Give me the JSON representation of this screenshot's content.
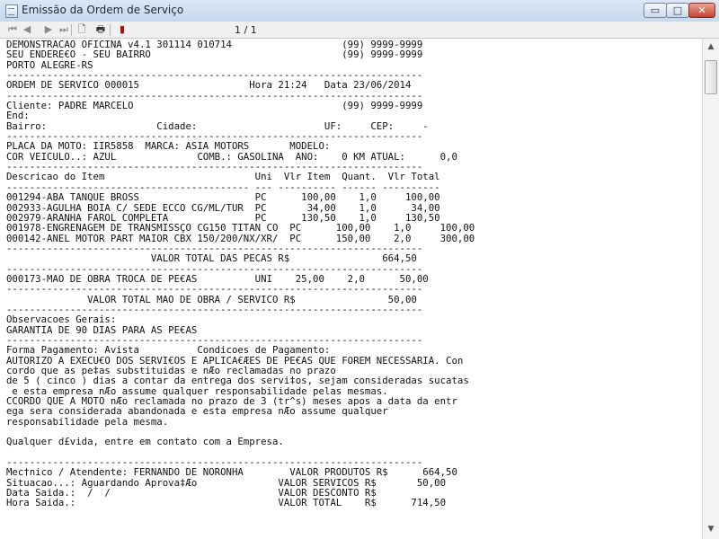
{
  "window": {
    "title": "Emissão da Ordem de Serviço",
    "min_glyph": "▭",
    "max_glyph": "□",
    "close_glyph": "✕"
  },
  "toolbar": {
    "page_indicator": "1 / 1",
    "icons": [
      "first-page-icon",
      "previous-page-icon",
      "next-page-icon",
      "last-page-icon",
      "page-setup-icon",
      "printer-icon",
      "exit-icon"
    ]
  },
  "report": {
    "lines": [
      "DEMONSTRACAO OFICINA v4.1 301114 010714                   (99) 9999-9999",
      "SEU ENDERE€O - SEU BAIRRO                                 (99) 9999-9999",
      "PORTO ALEGRE-RS",
      "------------------------------------------------------------------------",
      "ORDEM DE SERVICO 000015                   Hora 21:24   Data 23/06/2014",
      "------------------------------------------------------------------------",
      "Cliente: PADRE MARCELO                                    (99) 9999-9999",
      "End:",
      "Bairro:                   Cidade:                      UF:     CEP:     -",
      "------------------------------------------------------------------------",
      "PLACA DA MOTO: IIR5858  MARCA: ASIA MOTORS       MODELO:",
      "COR VEICULO..: AZUL              COMB.: GASOLINA  ANO:    0 KM ATUAL:      0,0",
      "------------------------------------------------------------------------",
      "Descricao do Item                          Uni  Vlr Item  Quant.  Vlr Total",
      "------------------------------------------ --- ---------- ------ ----------",
      "001294-ABA TANQUE BROSS                    PC      100,00    1,0     100,00",
      "002933-AGULHA BOIA C/ SEDE ECCO CG/ML/TUR  PC       34,00    1,0      34,00",
      "002979-ARANHA FAROL COMPLETA               PC      130,50    1,0     130,50",
      "001978-ENGRENAGEM DE TRANSMISSÇO CG150 TITAN CO  PC      100,00    1,0     100,00",
      "000142-ANEL MOTOR PART MAIOR CBX 150/200/NX/XR/  PC      150,00    2,0     300,00",
      "------------------------------------------------------------------------",
      "                         VALOR TOTAL DAS PECAS R$                664,50",
      "------------------------------------------------------------------------",
      "000173-MAO DE OBRA TROCA DE PE€AS          UNI    25,00    2,0      50,00",
      "------------------------------------------------------------------------",
      "              VALOR TOTAL MAO DE OBRA / SERVICO R$                50,00",
      "------------------------------------------------------------------------",
      "Observacoes Gerais:",
      "GARANTIA DE 90 DIAS PARA AS PE€AS",
      "------------------------------------------------------------------------",
      "Forma Pagamento: Avista          Condicoes de Pagamento:",
      "AUTORIZO A EXECU€O DOS SERVI€OS E APLICA€ÆES DE PE€AS QUE FOREM NECESSARIA. Con",
      "cordo que as pe‡as substituidas e nÆo reclamadas no prazo",
      "de 5 ( cinco ) dias a contar da entrega dos servi‡os, sejam consideradas sucatas",
      " e esta empresa nÆo assume qualquer responsabilidade pelas mesmas.",
      "CCORDO QUE A MOTO nÆo reclamada no prazo de 3 (tr^s) meses apos a data da entr",
      "ega sera considerada abandonada e esta empresa nÆo assume qualquer",
      "responsabilidade pela mesma.",
      "",
      "Qualquer d£vida, entre em contato com a Empresa.",
      "",
      "------------------------------------------------------------------------",
      "Mec†nico / Atendente: FERNANDO DE NORONHA        VALOR PRODUTOS R$      664,50",
      "Situacao...: Aguardando Aprova‡Æo              VALOR SERVICOS R$       50,00",
      "Data Saida.:  /  /                             VALOR DESCONTO R$",
      "Hora Saida.:                                   VALOR TOTAL    R$      714,50"
    ]
  }
}
